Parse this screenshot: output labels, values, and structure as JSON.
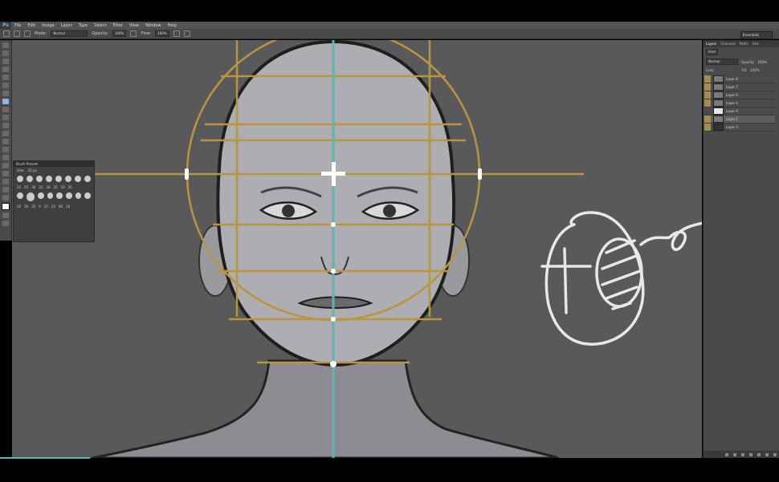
{
  "app": {
    "logo": "Ps"
  },
  "menu": [
    "File",
    "Edit",
    "Image",
    "Layer",
    "Type",
    "Select",
    "Filter",
    "View",
    "Window",
    "Help"
  ],
  "options": {
    "mode_label": "Mode:",
    "mode_value": "Normal",
    "opacity_label": "Opacity:",
    "opacity_value": "100%",
    "flow_label": "Flow:",
    "flow_value": "100%"
  },
  "workspace": "Essentials",
  "brush_panel": {
    "title": "Brush Presets",
    "size_label": "Size:",
    "size_value": "25 px",
    "sizes_row1": [
      "25",
      "55",
      "30",
      "25",
      "30",
      "25",
      "10",
      "20"
    ],
    "sizes_row2": [
      "25",
      "30",
      "25",
      "9",
      "25",
      "25",
      "60",
      "20"
    ]
  },
  "layers_panel": {
    "tabs": [
      "Layers",
      "Channels",
      "Paths",
      "Hist"
    ],
    "kind": "Kind",
    "blend": "Normal",
    "opacity_label": "Opacity:",
    "opacity_value": "100%",
    "lock_label": "Lock:",
    "fill_label": "Fill:",
    "fill_value": "100%",
    "layers": [
      {
        "name": "Layer 8"
      },
      {
        "name": "Layer 7"
      },
      {
        "name": "Layer 6"
      },
      {
        "name": "Layer 2"
      },
      {
        "name": "Layer 4"
      },
      {
        "name": "Layer 1"
      },
      {
        "name": "Layer 3"
      }
    ]
  },
  "colors": {
    "guide_gold": "#b8963f",
    "center_line": "#5fb3b0",
    "canvas_bg": "#59595b",
    "sketch": "#e8e8e8"
  }
}
